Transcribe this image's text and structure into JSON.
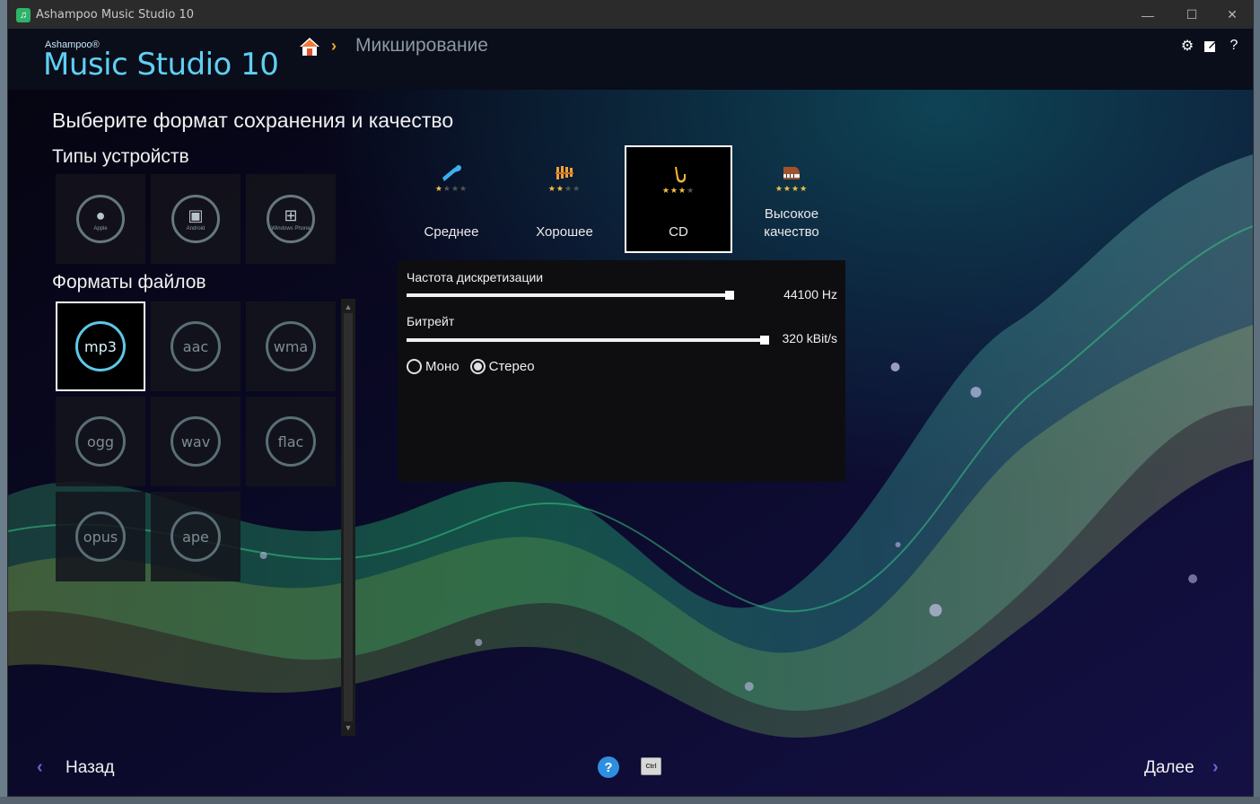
{
  "window": {
    "title": "Ashampoo Music Studio 10",
    "minimize_symbol": "—",
    "maximize_symbol": "☐",
    "close_symbol": "✕"
  },
  "header": {
    "brand_small": "Ashampoo®",
    "brand_name": "Music Studio",
    "brand_version": "10",
    "breadcrumb_separator": "›",
    "breadcrumb_current": "Микширование",
    "settings_icon": "gear-icon",
    "feedback_icon": "edit-icon",
    "help_label": "?"
  },
  "main": {
    "page_title": "Выберите формат сохранения и качество",
    "device_types_title": "Типы устройств",
    "devices": [
      {
        "name": "apple",
        "label": "Apple"
      },
      {
        "name": "android",
        "label": "Android"
      },
      {
        "name": "windows-phone",
        "label": "Windows Phone"
      }
    ],
    "file_formats_title": "Форматы файлов",
    "formats": [
      "mp3",
      "aac",
      "wma",
      "ogg",
      "wav",
      "flac",
      "opus",
      "ape"
    ],
    "selected_format": "mp3"
  },
  "quality": {
    "options": [
      {
        "label": "Среднее",
        "stars": 1,
        "icon": "trumpet-icon"
      },
      {
        "label": "Хорошее",
        "stars": 2,
        "icon": "xylophone-icon"
      },
      {
        "label": "CD",
        "stars": 3,
        "icon": "saxophone-icon"
      },
      {
        "label": "Высокое\nкачество",
        "stars": 4,
        "icon": "piano-icon"
      }
    ],
    "selected": "CD"
  },
  "settings": {
    "sample_rate_label": "Частота дискретизации",
    "sample_rate_value": "44100 Hz",
    "sample_rate_fraction": 0.9,
    "bitrate_label": "Битрейт",
    "bitrate_value": "320 kBit/s",
    "bitrate_fraction": 1.0,
    "channel_mono": "Моно",
    "channel_stereo": "Стерео",
    "channel_selected": "stereo"
  },
  "footer": {
    "back_label": "Назад",
    "next_label": "Далее",
    "help_label": "?",
    "ctrl_label": "Ctrl"
  },
  "colors": {
    "accent": "#5ed0f2",
    "star": "#f5c042",
    "nav_arrow": "#7b5bd9"
  }
}
